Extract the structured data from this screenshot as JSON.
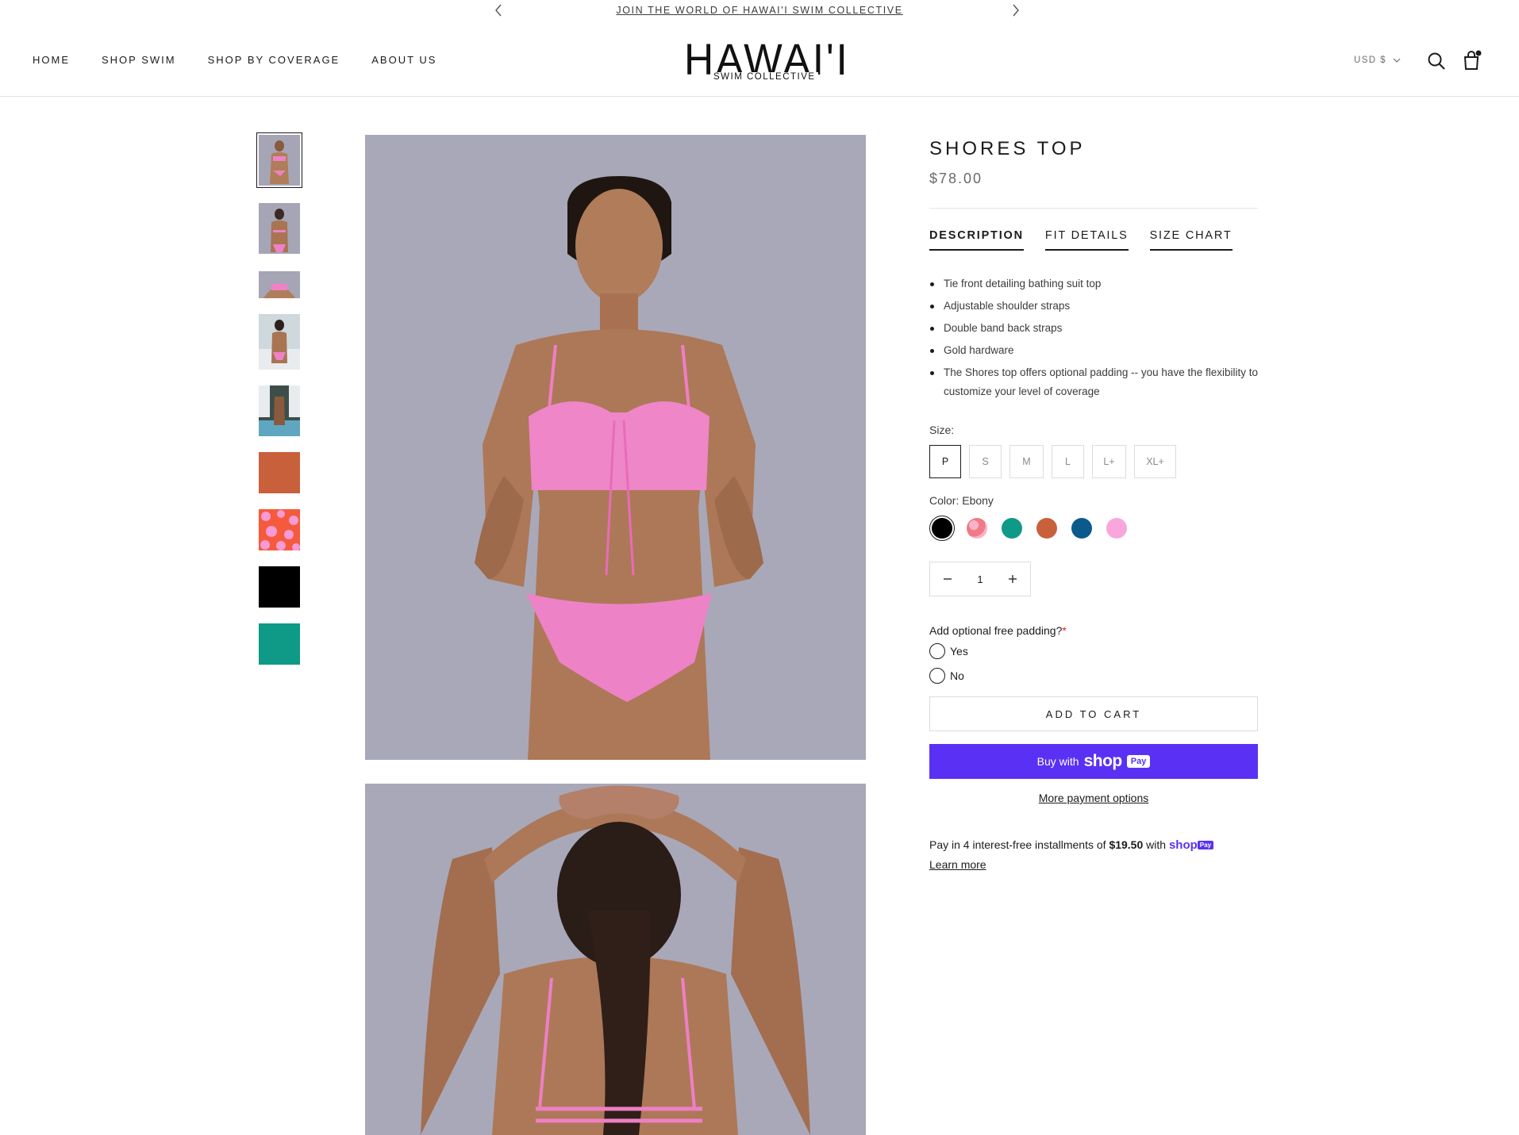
{
  "announcement": {
    "text": "JOIN THE WORLD OF HAWAI'I SWIM COLLECTIVE"
  },
  "header": {
    "nav": [
      "HOME",
      "SHOP SWIM",
      "SHOP BY COVERAGE",
      "ABOUT US"
    ],
    "logo": {
      "main": "HAWAI'I",
      "sub": "SWIM COLLECTIVE"
    },
    "currency": "USD $"
  },
  "product": {
    "title": "SHORES TOP",
    "price": "$78.00",
    "tabs": [
      "DESCRIPTION",
      "FIT DETAILS",
      "SIZE CHART"
    ],
    "active_tab": "DESCRIPTION",
    "description": [
      "Tie front detailing bathing suit top",
      "Adjustable shoulder straps",
      "Double band back straps",
      "Gold hardware",
      "The Shores top offers optional padding -- you have the flexibility to customize your level of coverage"
    ],
    "size_label": "Size:",
    "sizes": [
      "P",
      "S",
      "M",
      "L",
      "L+",
      "XL+"
    ],
    "selected_size": "P",
    "color_label": "Color: Ebony",
    "colors": [
      {
        "name": "Ebony",
        "hex": "#000000"
      },
      {
        "name": "Pink Floral",
        "hex": "#f07a86"
      },
      {
        "name": "Teal",
        "hex": "#0e9a86"
      },
      {
        "name": "Rust",
        "hex": "#c8603c"
      },
      {
        "name": "Ocean",
        "hex": "#0b5a8c"
      },
      {
        "name": "Pink",
        "hex": "#f9a6dc"
      }
    ],
    "quantity": "1",
    "padding_question": "Add optional free padding?",
    "padding_required_mark": "*",
    "padding_options": [
      "Yes",
      "No"
    ],
    "add_to_cart": "ADD TO CART",
    "shop_pay": {
      "prefix": "Buy with",
      "brand": "shop",
      "badge": "Pay"
    },
    "more_payment": "More payment options",
    "installments": {
      "prefix": "Pay in 4 interest-free installments of",
      "amount": "$19.50",
      "suffix": "with",
      "brand": "shop",
      "badge": "Pay",
      "learn_more": "Learn more"
    }
  },
  "thumbnails": [
    "front view",
    "back view",
    "detail crop",
    "back beach",
    "poolside",
    "rust swatch",
    "pink floral swatch",
    "ebony swatch",
    "teal swatch"
  ],
  "colors": {
    "text": "#1c1b1b",
    "shop_pay": "#5a31f4",
    "photo_bg": "#a9a8b8"
  }
}
